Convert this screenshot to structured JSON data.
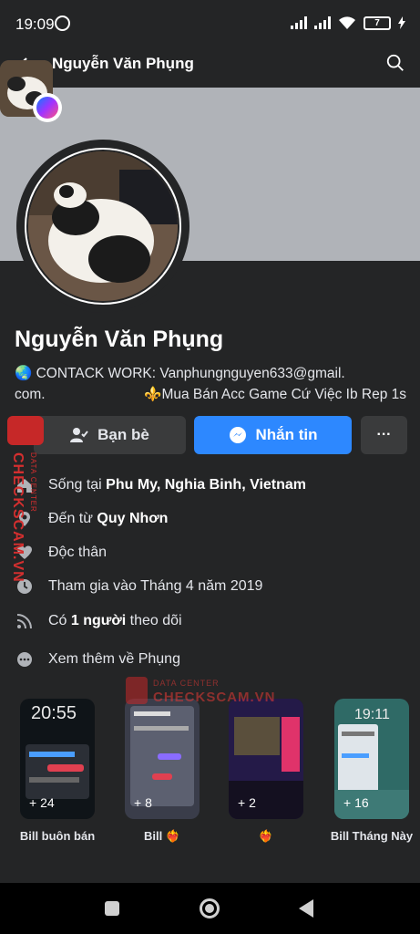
{
  "status_bar": {
    "time": "19:09",
    "battery": "7"
  },
  "header": {
    "title": "Nguyễn Văn Phụng"
  },
  "profile": {
    "name": "Nguyễn Văn Phụng",
    "bio_line1": "🌏 CONTACK WORK: Vanphungnguyen633@gmail.",
    "bio_line2a": "com.",
    "bio_line2b": "⚜️Mua Bán Acc Game Cứ Việc Ib Rep 1s"
  },
  "actions": {
    "friends": "Bạn bè",
    "message": "Nhắn tin",
    "more": "···"
  },
  "details": {
    "lives_prefix": "Sống tại ",
    "lives_place": "Phu My, Nghia Binh, Vietnam",
    "from_prefix": "Đến từ ",
    "from_place": "Quy Nhơn",
    "relationship": "Độc thân",
    "joined": "Tham gia vào Tháng 4 năm 2019",
    "followers_prefix": "Có ",
    "followers_count": "1 người",
    "followers_suffix": " theo dõi",
    "see_more": "Xem thêm về Phụng"
  },
  "highlights": [
    {
      "count": "+ 24",
      "label": "Bill buôn bán"
    },
    {
      "count": "+ 8",
      "label": "Bill ❤️‍🔥"
    },
    {
      "count": "+ 2",
      "label": "❤️‍🔥"
    },
    {
      "count": "+ 16",
      "label": "Bill Tháng Này"
    }
  ],
  "watermark": {
    "vertical": "CHECKSCAM.VN",
    "small": "DATA CENTER",
    "overlay_small": "DATA CENTER",
    "overlay_big": "CHECKSCAM.VN"
  },
  "colors": {
    "background": "#242526",
    "accent": "#2d88ff",
    "button": "#3a3b3c"
  }
}
